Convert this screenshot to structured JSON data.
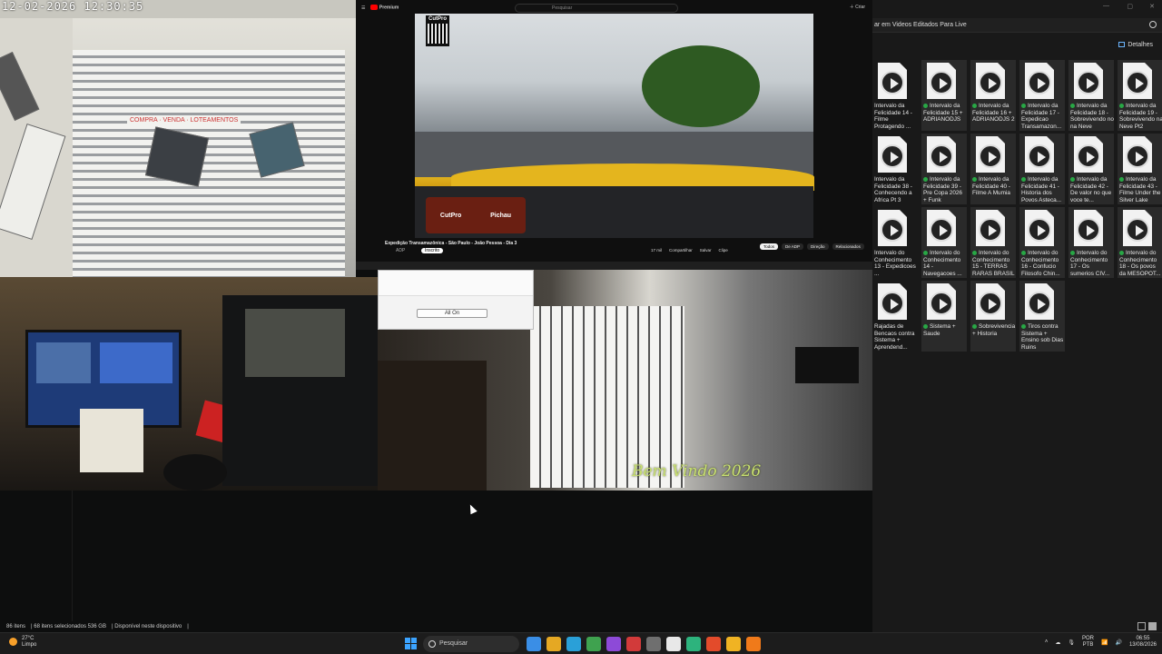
{
  "camera": {
    "timestamp": "12-02-2026  12:30:35",
    "watermark": "Bem Vindo 2026",
    "sign_text": "COMPRA · VENDA · LOTEAMENTOS"
  },
  "youtube": {
    "logo": "Premium",
    "search_placeholder": "Pesquisar",
    "video_title": "Expedição Transamazônica - São Paulo - João Pessoa - Dia 3",
    "channel": "ADP",
    "subscribe_label": "Inscrito",
    "qr_label": "CutPro",
    "sponsor_logos": [
      "CutPro",
      "Pichau"
    ],
    "actions": [
      "17 mil",
      "Compartilhar",
      "Salvar",
      "Clipe"
    ],
    "chips": [
      "Todos",
      "De ADP",
      "Direção",
      "Relacionados"
    ],
    "create_label": "Criar"
  },
  "popup": {
    "button_label": "All On"
  },
  "explorer": {
    "path_text": "ar em Videos Editados Para Live",
    "details_label": "Detalhes",
    "files": [
      {
        "name": "Intervalo da Felicidade 14 - Filme Protagendo ...",
        "status": false
      },
      {
        "name": "Intervalo da Felicidade 15 + ADRIANODJS",
        "status": true
      },
      {
        "name": "Intervalo da Felicidade 16 + ADRIANODJS 2",
        "status": true
      },
      {
        "name": "Intervalo da Felicidade 17 - Expedicao Transamazon...",
        "status": true
      },
      {
        "name": "Intervalo da Felicidade 18 - Sobrevivendo no na Neve",
        "status": true
      },
      {
        "name": "Intervalo da Felicidade 19 - Sobrevivendo na Neve Pt2",
        "status": true
      },
      {
        "name": "Intervalo da Felicidade 38 - Conhecendo a Africa Pt 3",
        "status": false
      },
      {
        "name": "Intervalo da Felicidade 39 - Pre Copa 2026 + Funk",
        "status": true
      },
      {
        "name": "Intervalo da Felicidade 40 - Filme A Mumia",
        "status": true
      },
      {
        "name": "Intervalo da Felicidade 41 - Historia dos Povos Asteca...",
        "status": true
      },
      {
        "name": "Intervalo da Felicidade 42 - De valor no que voce te...",
        "status": true
      },
      {
        "name": "Intervalo da Felicidade 43 - Filme Under the Silver Lake",
        "status": true
      },
      {
        "name": "Intervalo do Conhecimento 13 - Expedicoes ...",
        "status": false
      },
      {
        "name": "Intervalo do Conhecimento 14 - Navegacoes ...",
        "status": true
      },
      {
        "name": "Intervalo do Conhecimento 15 - TERRAS RARAS BRASIL",
        "status": true
      },
      {
        "name": "Intervalo do Conhecimento 16 - Confucio Filosofo Chin...",
        "status": true
      },
      {
        "name": "Intervalo do Conhecimento 17 - Os sumerios CIV...",
        "status": true
      },
      {
        "name": "Intervalo do Conhecimento 18 - Os povos da MESOPOT...",
        "status": true
      },
      {
        "name": "Rajadas de Bencaos contra Sistema + Aprendend...",
        "status": false
      },
      {
        "name": "Sistema + Saude",
        "status": true
      },
      {
        "name": "Sobrevivencia + Historia",
        "status": true
      },
      {
        "name": "Tiros contra Sistema + Ensino sob Dias Ruins",
        "status": true
      }
    ]
  },
  "statusbar": {
    "items": "86 itens",
    "selected": "68 itens selecionados  536 GB",
    "availability": "Disponível neste dispositivo"
  },
  "taskbar": {
    "temperature": "27°C",
    "weather": "Limpo",
    "search_label": "Pesquisar",
    "lang_top": "POR",
    "lang_bottom": "PTB",
    "time": "06:55",
    "date": "13/08/2026",
    "app_colors": [
      "#3a8ee6",
      "#e5a823",
      "#2aa0d8",
      "#3fa24f",
      "#8d4ad8",
      "#d23a3a",
      "#6f6f6f",
      "#e8e8e8",
      "#2db37d",
      "#e34b2b",
      "#f0b323",
      "#f07a1a"
    ]
  }
}
